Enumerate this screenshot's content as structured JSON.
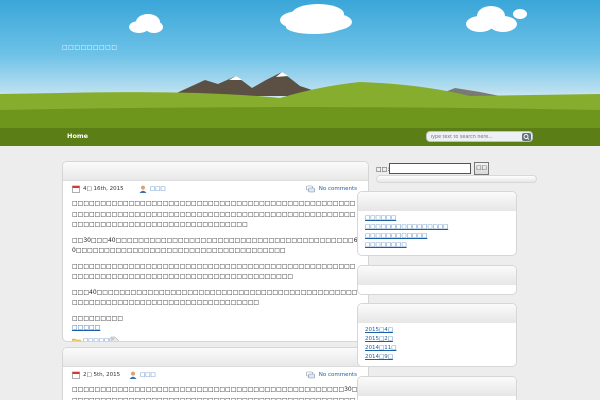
{
  "site": {
    "title": "□□□□□□□□□",
    "nav_home": "Home",
    "search_placeholder": "Type text to search here..."
  },
  "posts": [
    {
      "date": "4□ 16th, 2015",
      "author": "□□□",
      "comments": "No comments",
      "paragraphs": [
        "□□□□□□□□□□□□□□□□□□□□□□□□□□□□□□□□□□□□□□□□□□□□□□□□□□□□□□□□□□□□□□□□□□□□□□□□□□□□□□□□□□□□□□□□□□□□□□□□□□□□□□□□□□□□□□□□□□□□□□□□□□□□□□□□□□□",
        "□□30□□□40□□□□□□□□□□□□□□□□□□□□□□□□□□□□□□□□□□□□□□□□□□60□□□□□□□□□□□□□□□□□□□□□□□□□□□□□□□□□□□□□",
        "□□□□□□□□□□□□□□□□□□□□□□□□□□□□□□□□□□□□□□□□□□□□□□□□□□□□□□□□□□□□□□□□□□□□□□□□□□□□□□□□□□□□□□□□□",
        "□□□40□□□□□□□□□□□□□□□□□□□□□□□□□□□□□□□□□□□□□□□□□□□□□□□□□□□□□□□□□□□□□□□□□□□□□□□□□□□□□□□"
      ],
      "more_label": "□□□□□□□□□",
      "more_link": "□□□□□",
      "category": "□□□□□□"
    },
    {
      "date": "2□ 5th, 2015",
      "author": "□□□",
      "comments": "No comments",
      "paragraphs": [
        "□□□□□□□□□□□□□□□□□□□□□□□□□□□□□□□□□□□□□□□□□□□□□□□□30□□□□□□□□□□□□□□□□□□□□□□□□□□□□□□□□□□□□□□□□□□□□□□□□□□□□□□□□□□□□"
      ]
    }
  ],
  "sidebar": {
    "search_label": "□□:",
    "search_button": "□□",
    "recent": [
      "□□□□□□",
      "□□□□□□□□□□□□□□□□",
      "□□□□□□□□□□□□",
      "□□□□□□□□"
    ],
    "archives": [
      "2015□4□",
      "2015□2□",
      "2014□11□",
      "2014□9□"
    ]
  }
}
